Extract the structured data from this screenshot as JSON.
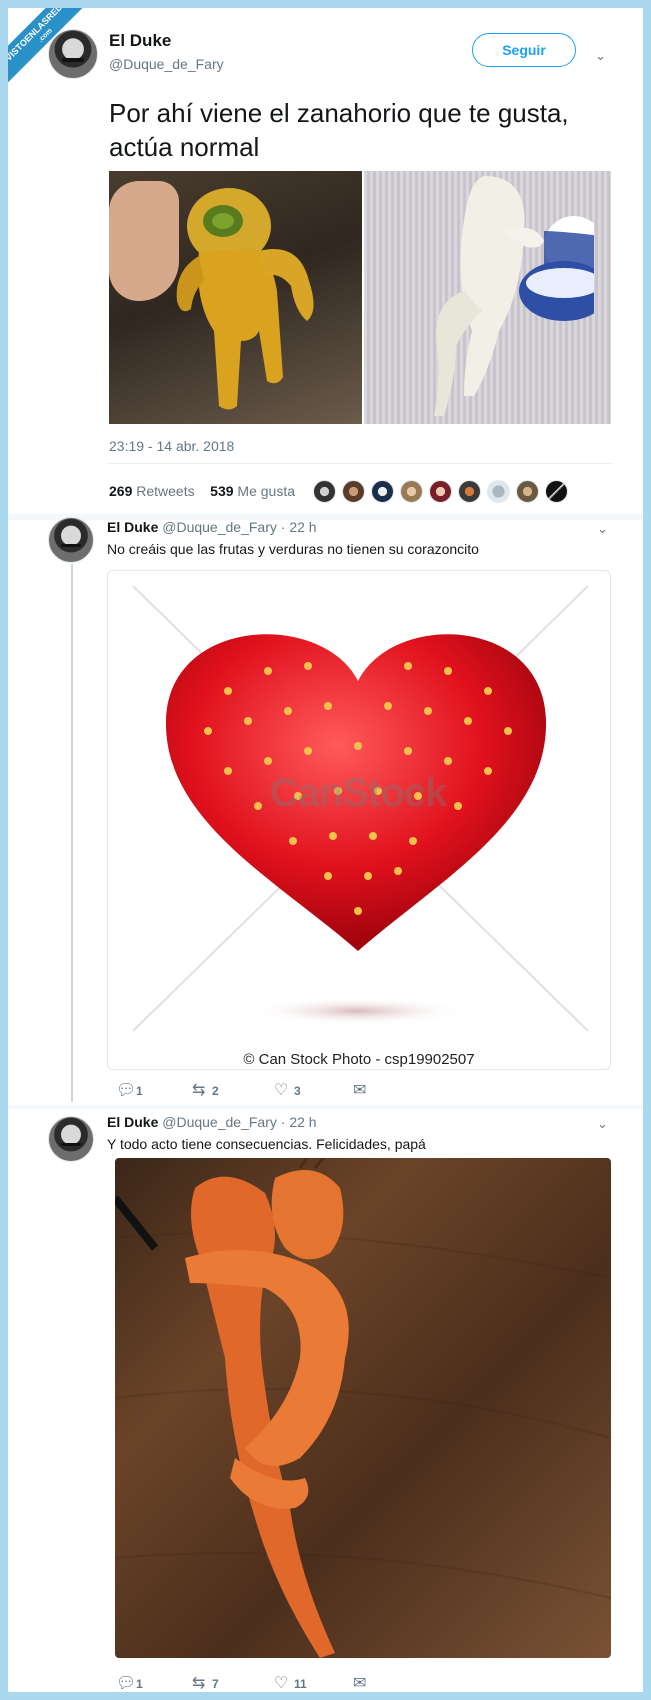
{
  "watermark": {
    "line1": "VISTOENLASREDES",
    "line2": ".com"
  },
  "main_tweet": {
    "name": "El Duke",
    "handle": "@Duque_de_Fary",
    "follow_label": "Seguir",
    "text": "Por ahí viene el zanahorio que te gusta, actúa normal",
    "timestamp": "23:19 - 14 abr. 2018",
    "retweets_count": "269",
    "retweets_label": "Retweets",
    "likes_count": "539",
    "likes_label": "Me gusta"
  },
  "replies": [
    {
      "name": "El Duke",
      "handle": "@Duque_de_Fary",
      "time": "· 22 h",
      "text": "No creáis que las frutas y verduras no tienen su corazoncito",
      "image_watermark": "CanStock",
      "image_caption": "© Can Stock Photo - csp19902507",
      "replies": "1",
      "retweets": "2",
      "likes": "3"
    },
    {
      "name": "El Duke",
      "handle": "@Duque_de_Fary",
      "time": "· 22 h",
      "text": "Y todo acto tiene consecuencias. Felicidades, papá",
      "replies": "1",
      "retweets": "7",
      "likes": "11"
    }
  ],
  "icons": {
    "reply": "speech-bubble-icon",
    "retweet": "retweet-icon",
    "like": "heart-icon",
    "dm": "envelope-icon",
    "more": "chevron-down-icon"
  },
  "colors": {
    "accent": "#1da1f2",
    "secondary_text": "#657786",
    "page_border": "#aad8ee"
  }
}
